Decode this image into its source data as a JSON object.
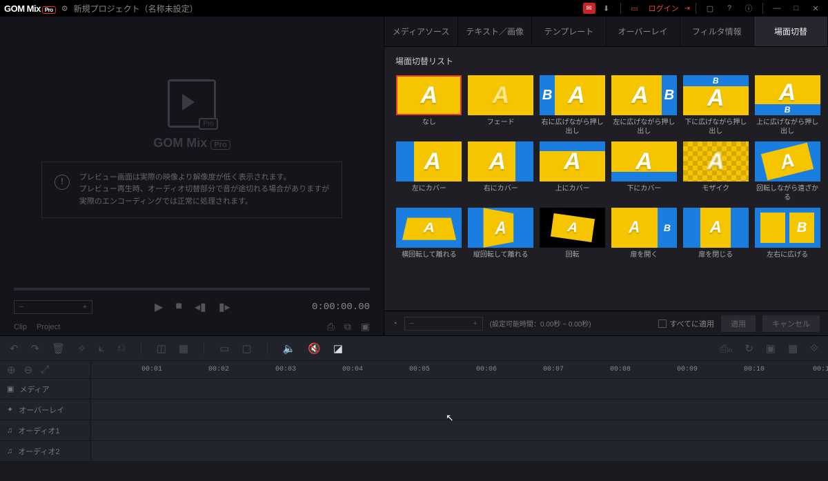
{
  "titlebar": {
    "brand": "GOM Mix",
    "brand_badge": "Pro",
    "project_title": "新規プロジェクト（名称未設定）",
    "login": "ログイン"
  },
  "preview": {
    "brand": "GOM Mix",
    "brand_badge": "Pro",
    "info_line1": "プレビュー画面は実際の映像より解像度が低く表示されます。",
    "info_line2": "プレビュー再生時、オーディオ切替部分で音が途切れる場合がありますが",
    "info_line3": "実際のエンコーディングでは正常に処理されます。",
    "zoom_value": "",
    "timecode": "0:00:00.00",
    "clip_label": "Clip",
    "project_label": "Project"
  },
  "tabs": [
    {
      "label": "メディアソース"
    },
    {
      "label": "テキスト／画像"
    },
    {
      "label": "テンプレート"
    },
    {
      "label": "オーバーレイ"
    },
    {
      "label": "フィルタ情報"
    },
    {
      "label": "場面切替",
      "active": true
    }
  ],
  "panel": {
    "header": "場面切替リスト",
    "duration_hint": "(設定可能時間：0.00秒 ~ 0.00秒)",
    "apply_all": "すべてに適用",
    "apply": "適用",
    "cancel": "キャンセル"
  },
  "transitions": [
    {
      "label": "なし",
      "selected": true,
      "style": "plain"
    },
    {
      "label": "フェード",
      "style": "fade"
    },
    {
      "label": "右に広げながら押し出し",
      "style": "push-r"
    },
    {
      "label": "左に広げながら押し出し",
      "style": "push-l"
    },
    {
      "label": "下に広げながら押し出し",
      "style": "push-d"
    },
    {
      "label": "上に広げながら押し出し",
      "style": "push-u"
    },
    {
      "label": "左にカバー",
      "style": "cover-l"
    },
    {
      "label": "右にカバー",
      "style": "cover-r"
    },
    {
      "label": "上にカバー",
      "style": "cover-u"
    },
    {
      "label": "下にカバー",
      "style": "cover-d"
    },
    {
      "label": "モザイク",
      "style": "mosaic"
    },
    {
      "label": "回転しながら遠ざかる",
      "style": "rot-away"
    },
    {
      "label": "横回転して離れる",
      "style": "rot-h"
    },
    {
      "label": "縦回転して離れる",
      "style": "rot-v"
    },
    {
      "label": "回転",
      "style": "rotate"
    },
    {
      "label": "扉を開く",
      "style": "door-open"
    },
    {
      "label": "扉を閉じる",
      "style": "door-close"
    },
    {
      "label": "左右に広げる",
      "style": "spread"
    }
  ],
  "ruler": [
    "00:01",
    "00:02",
    "00:03",
    "00:04",
    "00:05",
    "00:06",
    "00:07",
    "00:08",
    "00:09",
    "00:10",
    "00:1"
  ],
  "tracks": [
    {
      "icon": "▣",
      "label": "メディア"
    },
    {
      "icon": "✦",
      "label": "オーバーレイ"
    },
    {
      "icon": "♫",
      "label": "オーディオ1"
    },
    {
      "icon": "♫",
      "label": "オーディオ2"
    }
  ]
}
